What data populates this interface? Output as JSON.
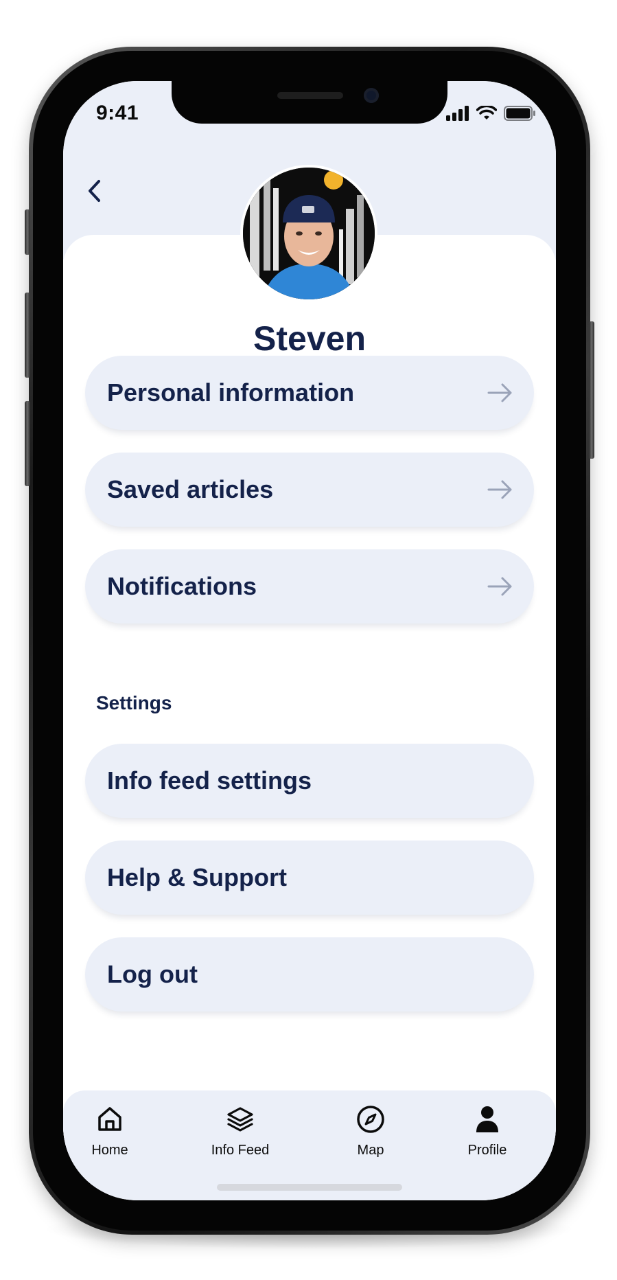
{
  "status_bar": {
    "time": "9:41"
  },
  "profile": {
    "name": "Steven"
  },
  "menu": [
    {
      "label": "Personal information",
      "has_arrow": true
    },
    {
      "label": "Saved articles",
      "has_arrow": true
    },
    {
      "label": "Notifications",
      "has_arrow": true
    }
  ],
  "settings": {
    "heading": "Settings",
    "items": [
      {
        "label": "Info feed settings"
      },
      {
        "label": "Help & Support"
      },
      {
        "label": "Log out"
      }
    ]
  },
  "tabbar": {
    "tabs": [
      {
        "label": "Home",
        "icon": "home-icon"
      },
      {
        "label": "Info Feed",
        "icon": "layers-icon"
      },
      {
        "label": "Map",
        "icon": "compass-icon"
      },
      {
        "label": "Profile",
        "icon": "person-icon",
        "active": true
      }
    ]
  },
  "colors": {
    "primary_text": "#14224a",
    "pill_background": "#ebeff8",
    "arrow": "#9aa3b8"
  }
}
